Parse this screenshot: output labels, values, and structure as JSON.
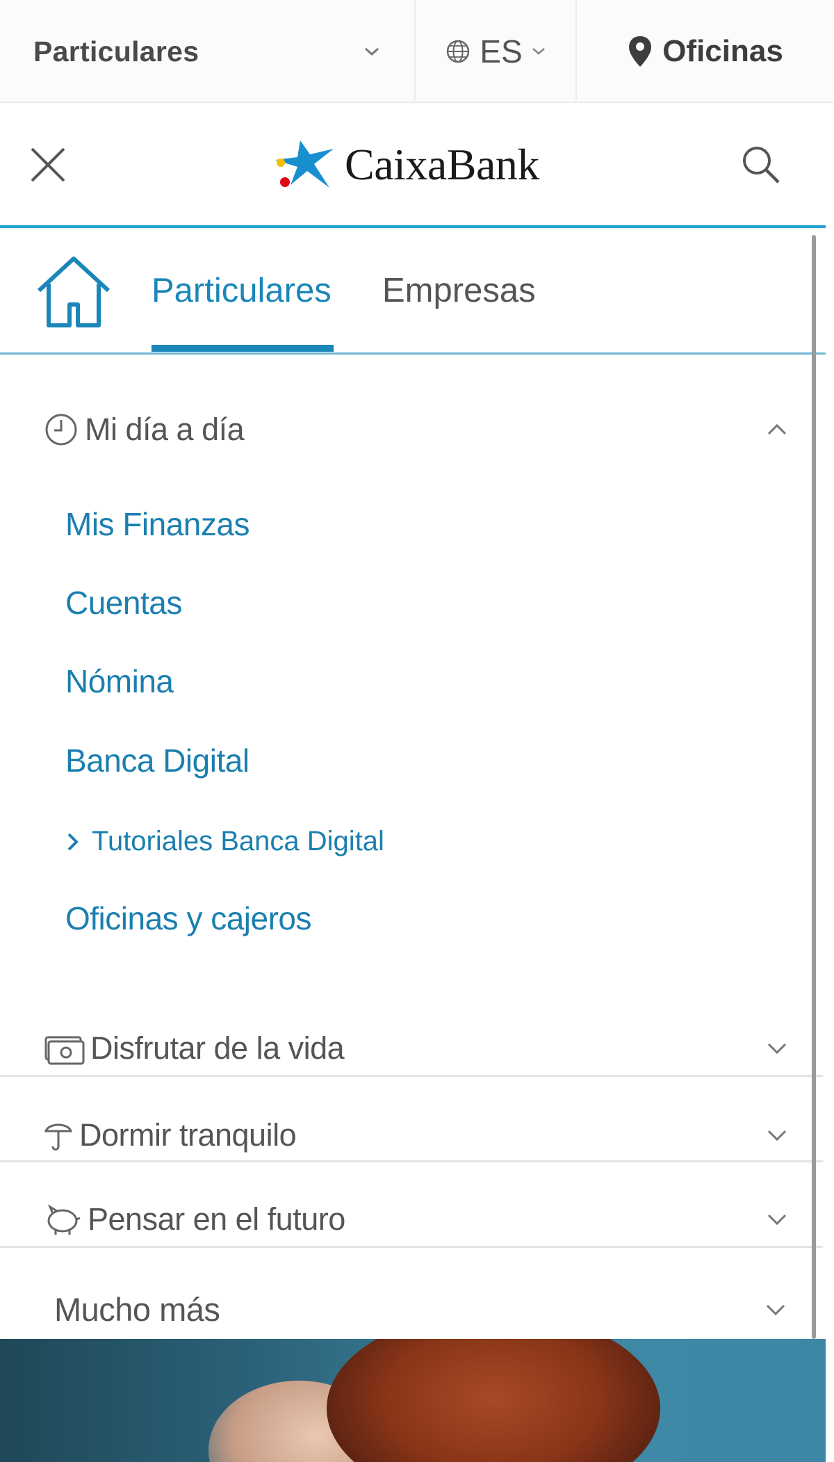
{
  "topbar": {
    "segment_label": "Particulares",
    "language_label": "ES",
    "offices_label": "Oficinas"
  },
  "header": {
    "logo_text": "CaixaBank",
    "accent_color": "#27a2d4"
  },
  "tabs": {
    "active": "Particulares",
    "inactive": "Empresas"
  },
  "menu": {
    "sections": [
      {
        "label": "Mi día a día",
        "icon": "clock-icon",
        "expanded": true,
        "items": [
          "Mis Finanzas",
          "Cuentas",
          "Nómina",
          "Banca Digital"
        ],
        "subitem": "Tutoriales Banca Digital",
        "last_item": "Oficinas y cajeros"
      },
      {
        "label": "Disfrutar de la vida",
        "icon": "money-icon",
        "expanded": false
      },
      {
        "label": "Dormir tranquilo",
        "icon": "umbrella-icon",
        "expanded": false
      },
      {
        "label": "Pensar en el futuro",
        "icon": "piggy-bank-icon",
        "expanded": false
      },
      {
        "label": "Mucho más",
        "icon": "",
        "expanded": false
      }
    ]
  },
  "colors": {
    "link_blue": "#1b7fb0",
    "tab_blue": "#1b86b8",
    "text_gray": "#555555"
  }
}
